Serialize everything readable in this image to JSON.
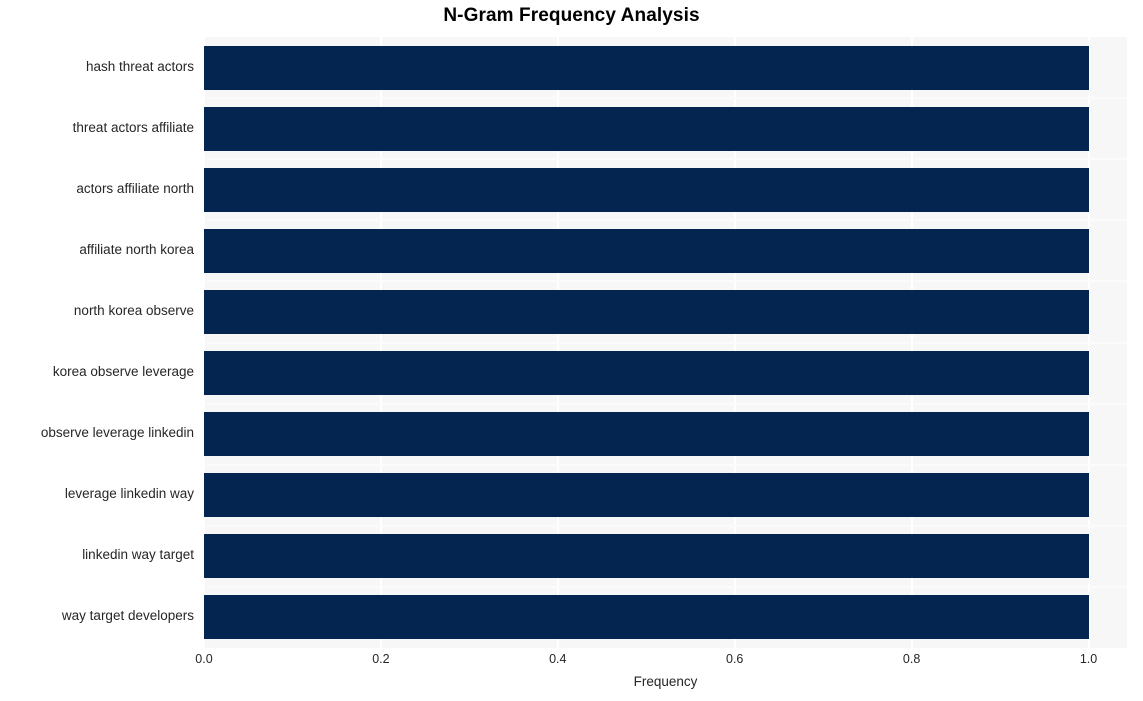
{
  "chart_data": {
    "type": "bar",
    "orientation": "horizontal",
    "title": "N-Gram Frequency Analysis",
    "xlabel": "Frequency",
    "ylabel": "",
    "categories": [
      "hash threat actors",
      "threat actors affiliate",
      "actors affiliate north",
      "affiliate north korea",
      "north korea observe",
      "korea observe leverage",
      "observe leverage linkedin",
      "leverage linkedin way",
      "linkedin way target",
      "way target developers"
    ],
    "values": [
      1.0,
      1.0,
      1.0,
      1.0,
      1.0,
      1.0,
      1.0,
      1.0,
      1.0,
      1.0
    ],
    "xticks": [
      "0.0",
      "0.2",
      "0.4",
      "0.6",
      "0.8",
      "1.0"
    ],
    "xtick_values": [
      0.0,
      0.2,
      0.4,
      0.6,
      0.8,
      1.0
    ],
    "xlim": [
      0.0,
      1.0435
    ],
    "grid": "vertical-and-horizontal",
    "legend": null,
    "colors": {
      "bar": "#03254f",
      "plot_background": "#f7f7f7",
      "figure_background": "#ffffff",
      "gridline": "#ffffff",
      "text": "#262626",
      "title_text": "#000000"
    }
  }
}
